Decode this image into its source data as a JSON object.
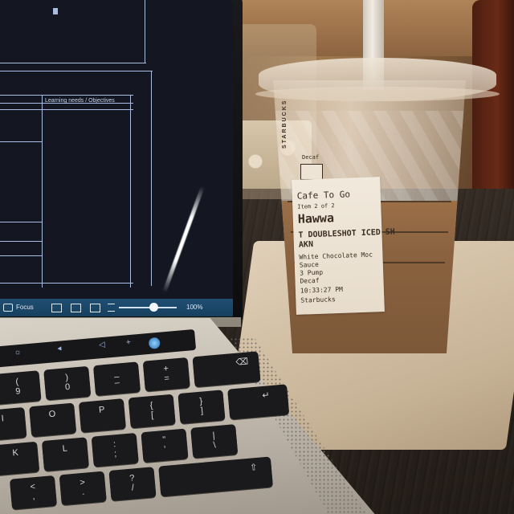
{
  "screen": {
    "column_header": "Learning needs / Objectives",
    "status_bar": {
      "focus_label": "Focus",
      "zoom_level": "100%",
      "zoom_slider_fraction": 0.6
    }
  },
  "cup": {
    "brand_print": "STARBUCKS",
    "sticker": {
      "decaf_label": "Decaf",
      "store": "Cafe To Go",
      "item_count": "Item 2 of 2",
      "customer_name": "Hawwa",
      "drink": "T DOUBLESHOT ICED SH",
      "drink_cont": "AKN",
      "mod1": "White Chocolate Moc",
      "mod2": "Sauce",
      "mod3": "3 Pump",
      "mod4": "Decaf",
      "time": "10:33:27 PM",
      "customer": "Starbucks"
    }
  },
  "keyboard": {
    "touchbar": [
      "☼",
      "◂",
      "◁",
      "+"
    ],
    "rows": [
      [
        [
          "(",
          "9"
        ],
        [
          ")",
          "0"
        ],
        [
          "_",
          "–"
        ],
        [
          "+",
          "="
        ]
      ],
      [
        [
          "I",
          ""
        ],
        [
          "O",
          ""
        ],
        [
          "P",
          ""
        ],
        [
          "{",
          "["
        ],
        [
          "}",
          "]"
        ]
      ],
      [
        [
          "K",
          ""
        ],
        [
          "L",
          ""
        ],
        [
          ":",
          ";"
        ],
        [
          "\"",
          "'"
        ],
        [
          "|",
          "\\"
        ]
      ],
      [
        [
          "<",
          ","
        ],
        [
          ">",
          "."
        ],
        [
          "?",
          "/"
        ],
        [
          "⇧",
          ""
        ]
      ]
    ]
  }
}
